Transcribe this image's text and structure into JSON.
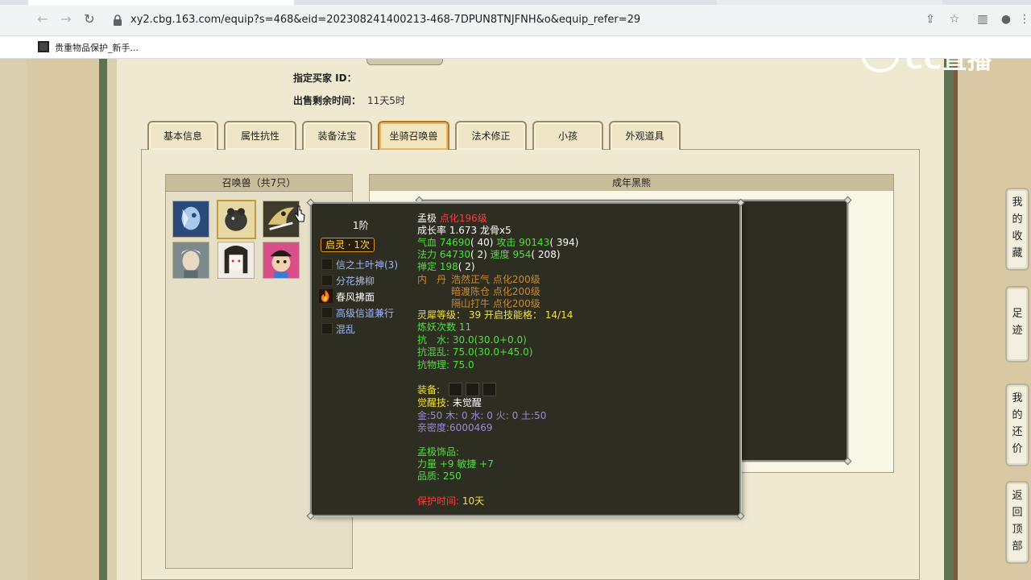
{
  "browser": {
    "url": "xy2.cbg.163.com/equip?s=468&eid=202308241400213-468-7DPUN8TNJFNH&o&equip_refer=29",
    "bookmark_label": "贵重物品保护_新手...",
    "watermark": "CC直播"
  },
  "info": {
    "buyer_id_label": "指定买家 ID：",
    "remaining_label": "出售剩余时间：",
    "remaining_value": "11天5时"
  },
  "tabs": [
    {
      "label": "基本信息"
    },
    {
      "label": "属性抗性"
    },
    {
      "label": "装备法宝"
    },
    {
      "label": "坐骑召唤兽"
    },
    {
      "label": "法术修正"
    },
    {
      "label": "小孩"
    },
    {
      "label": "外观道具"
    }
  ],
  "summon_panel": {
    "title": "召唤兽（共7只）"
  },
  "right_panel": {
    "title": "成年黑熊"
  },
  "tooltip": {
    "stage": "1阶",
    "awaken": "启灵 · 1次",
    "skills": [
      "信之土叶神(3)",
      "分花拂柳",
      "春风拂面",
      "高级信道兼行",
      "混乱"
    ],
    "name": "孟极",
    "name_tag": "点化196级",
    "growth": "成长率 1.673 龙骨x5",
    "hp_label": "气血",
    "hp": "74690",
    "hp_extra": "( 40)",
    "atk_label": "攻击",
    "atk": "90143",
    "atk_extra": "( 394)",
    "mp_label": "法力",
    "mp": "64730",
    "mp_extra": "( 2)",
    "spd_label": "速度",
    "spd": "954",
    "spd_extra": "( 208)",
    "med_label": "禅定",
    "med": "198",
    "med_extra": "( 2)",
    "neidan_label": "内　丹",
    "neidan": [
      "浩然正气 点化200级",
      "暗渡陈仓 点化200级",
      "隔山打牛 点化200级"
    ],
    "lingxi_label": "灵犀等级：",
    "lingxi_value": "39",
    "lingxi_open_label": "开启技能格：",
    "lingxi_open_value": "14/14",
    "lianyao": "炼妖次数 11",
    "kang_shui_label": "抗　水:",
    "kang_shui": "30.0(30.0+0.0)",
    "kang_hunluan_label": "抗混乱:",
    "kang_hunluan": "75.0(30.0+45.0)",
    "kang_wuli_label": "抗物理:",
    "kang_wuli": "75.0",
    "equip_label": "装备:",
    "awake_label": "觉醒技:",
    "awake_value": "未觉醒",
    "elements": "金:50 木: 0 水: 0 火: 0 土:50",
    "intimacy": "亲密度:6000469",
    "ornament_label": "孟极饰品:",
    "ornament_attr": "力量 +9 敏捷 +7",
    "ornament_quality": "品质:  250",
    "protect_label": "保护时间:",
    "protect_value": "10天"
  },
  "side_buttons": [
    {
      "chars": [
        "我",
        "的",
        "收",
        "藏"
      ]
    },
    {
      "chars": [
        "足",
        "迹"
      ]
    },
    {
      "chars": [
        "我",
        "的",
        "还",
        "价"
      ]
    },
    {
      "chars": [
        "返",
        "回",
        "顶",
        "部"
      ]
    }
  ]
}
